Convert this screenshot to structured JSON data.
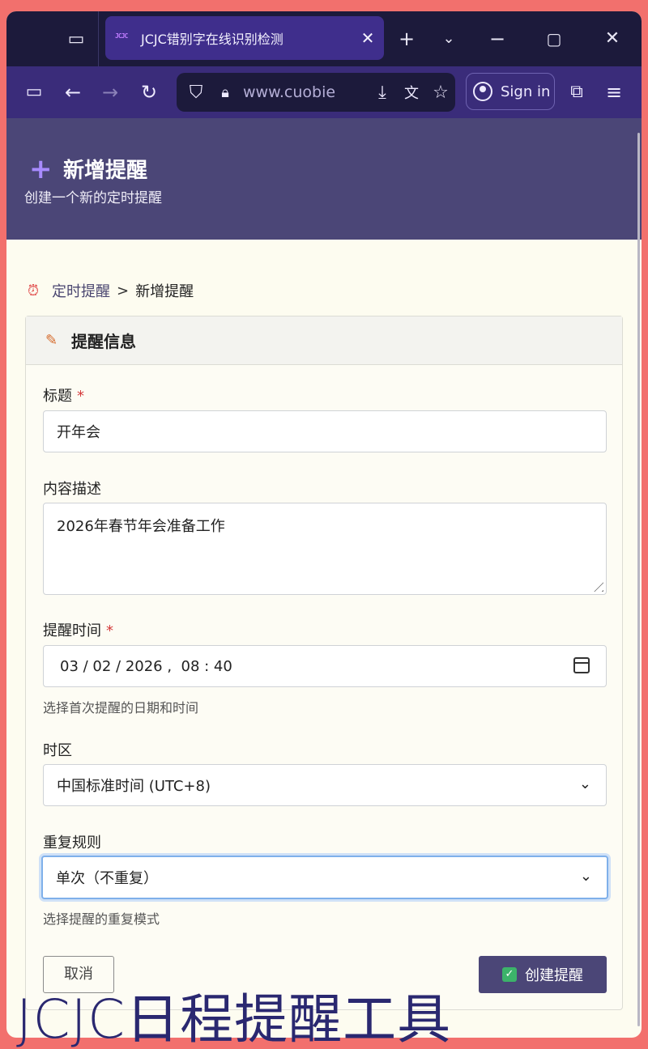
{
  "browser": {
    "tab": {
      "favicon_text": "JCJC",
      "title": "JCJC错别字在线识别检测"
    },
    "url": "www.cuobie",
    "sign_in": "Sign in"
  },
  "header": {
    "title": "新增提醒",
    "subtitle": "创建一个新的定时提醒"
  },
  "breadcrumb": {
    "parent": "定时提醒",
    "separator": ">",
    "current": "新增提醒"
  },
  "card": {
    "title": "提醒信息"
  },
  "form": {
    "title_label": "标题",
    "title_value": "开年会",
    "required_mark": "*",
    "desc_label": "内容描述",
    "desc_value": "2026年春节年会准备工作",
    "time_label": "提醒时间",
    "time_value": "03 / 02 / 2026 ,  08 : 40",
    "time_hint": "选择首次提醒的日期和时间",
    "tz_label": "时区",
    "tz_value": "中国标准时间 (UTC+8)",
    "repeat_label": "重复规则",
    "repeat_value": "单次（不重复）",
    "repeat_hint": "选择提醒的重复模式",
    "cancel": "取消",
    "create": "创建提醒"
  },
  "watermark": "JCJC日程提醒工具"
}
